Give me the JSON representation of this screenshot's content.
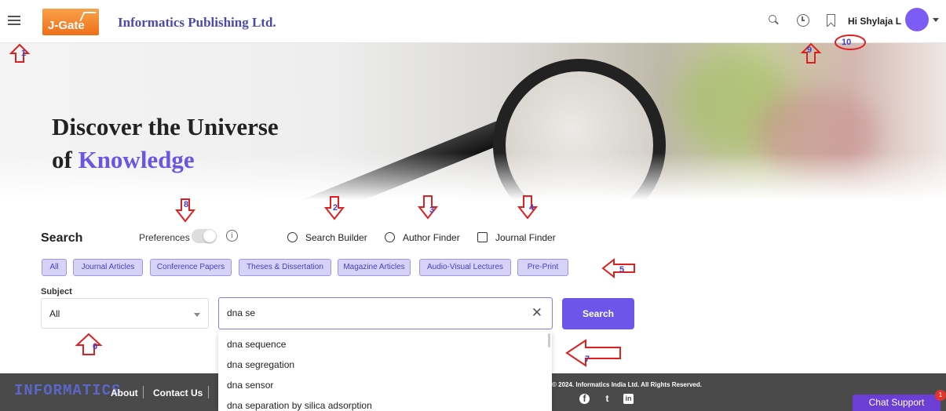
{
  "header": {
    "logo_text": "J-Gate",
    "org_name": "Informatics Publishing Ltd.",
    "greeting": "Hi Shylaja L",
    "icons": [
      "menu-icon",
      "search-icon",
      "history-clock-icon",
      "bookmark-icon",
      "avatar",
      "chevron-down-icon"
    ]
  },
  "hero": {
    "title_line1": "Discover the Universe",
    "title_line2_prefix": "of ",
    "title_line2_accent": "Knowledge",
    "accent_color": "#6a55e4"
  },
  "search": {
    "label": "Search",
    "preferences_label": "Preferences",
    "preferences_enabled": false,
    "tools": [
      {
        "label": "Search Builder",
        "icon": "search-builder-icon"
      },
      {
        "label": "Author Finder",
        "icon": "person-icon"
      },
      {
        "label": "Journal Finder",
        "icon": "journal-icon"
      }
    ],
    "chips": [
      "All",
      "Journal Articles",
      "Conference Papers",
      "Theses & Dissertation",
      "Magazine Articles",
      "Audio-Visual Lectures",
      "Pre-Print"
    ],
    "subject_label": "Subject",
    "subject_value": "All",
    "query_value": "dna se",
    "button_label": "Search",
    "button_color": "#6e55ea",
    "suggestions": [
      "dna sequence",
      "dna segregation",
      "dna sensor",
      "dna separation by silica adsorption"
    ]
  },
  "footer": {
    "logo_text": "INFORMATICS",
    "links": [
      "About",
      "Contact Us"
    ],
    "copyright": "© 2024. Informatics India Ltd. All Rights Reserved.",
    "social_icons": [
      "facebook-icon",
      "twitter-icon",
      "linkedin-icon"
    ],
    "chat_label": "Chat Support",
    "chat_badge": "1"
  },
  "annotations": [
    "1",
    "2",
    "3",
    "4",
    "5",
    "6",
    "7",
    "8",
    "9",
    "10"
  ]
}
